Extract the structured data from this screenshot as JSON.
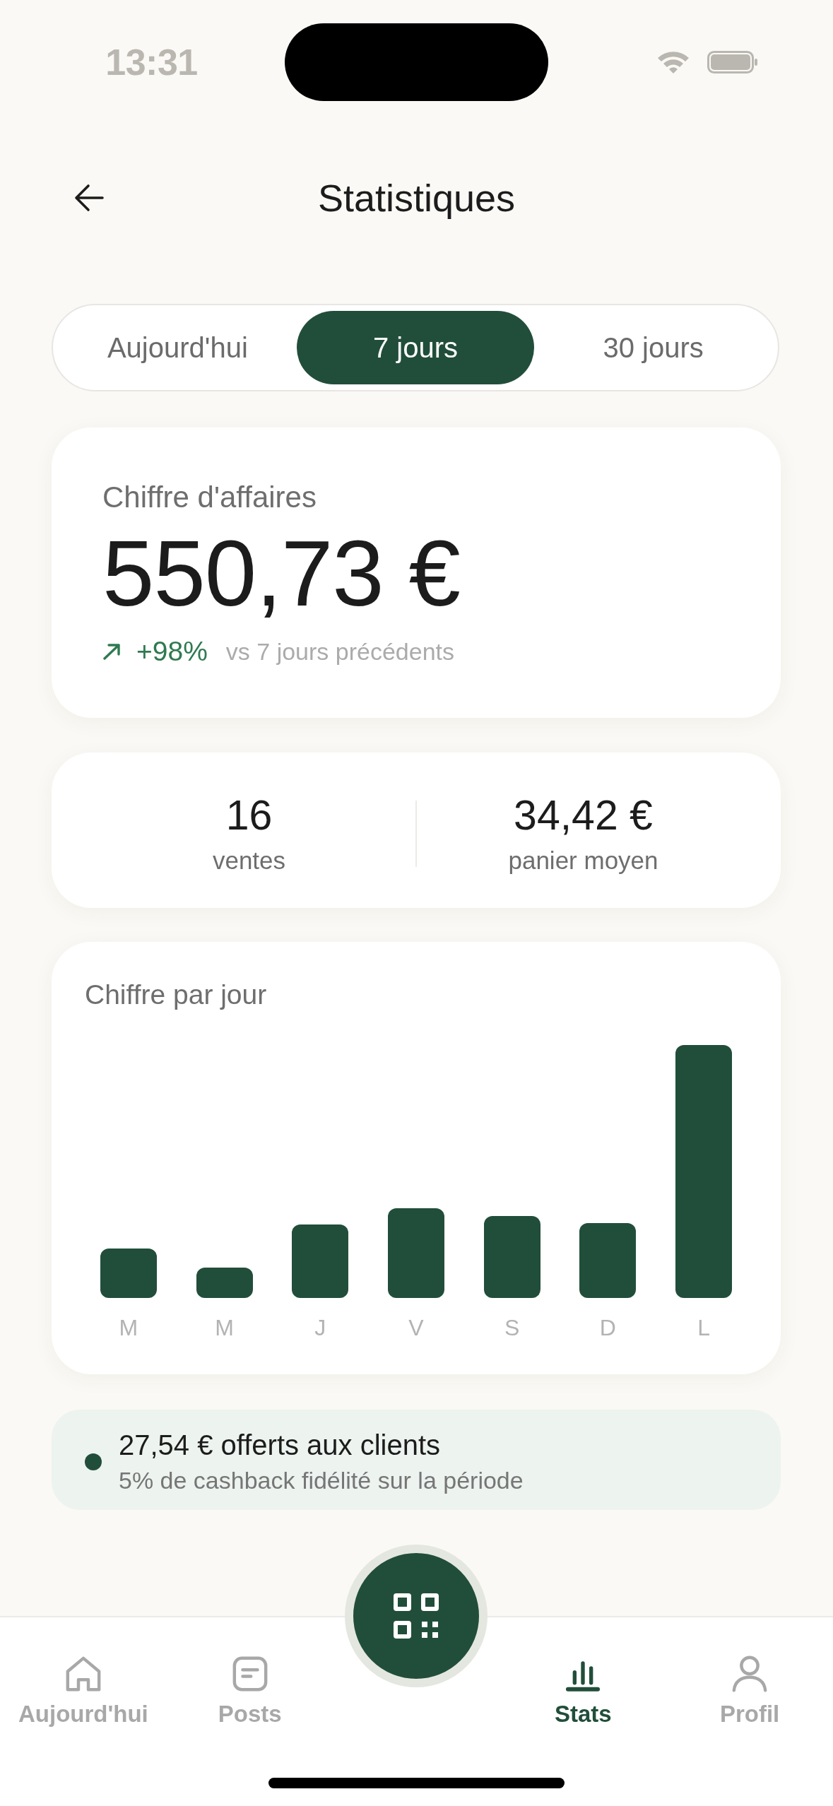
{
  "status_bar": {
    "time": "13:31"
  },
  "header": {
    "title": "Statistiques"
  },
  "period_tabs": [
    {
      "label": "Aujourd'hui",
      "selected": false
    },
    {
      "label": "7 jours",
      "selected": true
    },
    {
      "label": "30 jours",
      "selected": false
    }
  ],
  "revenue": {
    "label": "Chiffre d'affaires",
    "amount": "550,73 €",
    "change": "+98%",
    "comparison": "vs 7 jours précédents"
  },
  "summary": [
    {
      "value": "16",
      "label": "ventes"
    },
    {
      "value": "34,42 €",
      "label": "panier moyen"
    }
  ],
  "daily_chart": {
    "title": "Chiffre par jour",
    "days": [
      "M",
      "M",
      "J",
      "V",
      "S",
      "D",
      "L"
    ]
  },
  "cashback": {
    "title": "27,54 € offerts aux clients",
    "subtitle": "5% de cashback fidélité sur la période"
  },
  "bottom_nav": [
    {
      "label": "Aujourd'hui",
      "selected": false
    },
    {
      "label": "Posts",
      "selected": false
    },
    {
      "label": "Stats",
      "selected": true
    },
    {
      "label": "Profil",
      "selected": false
    }
  ]
}
